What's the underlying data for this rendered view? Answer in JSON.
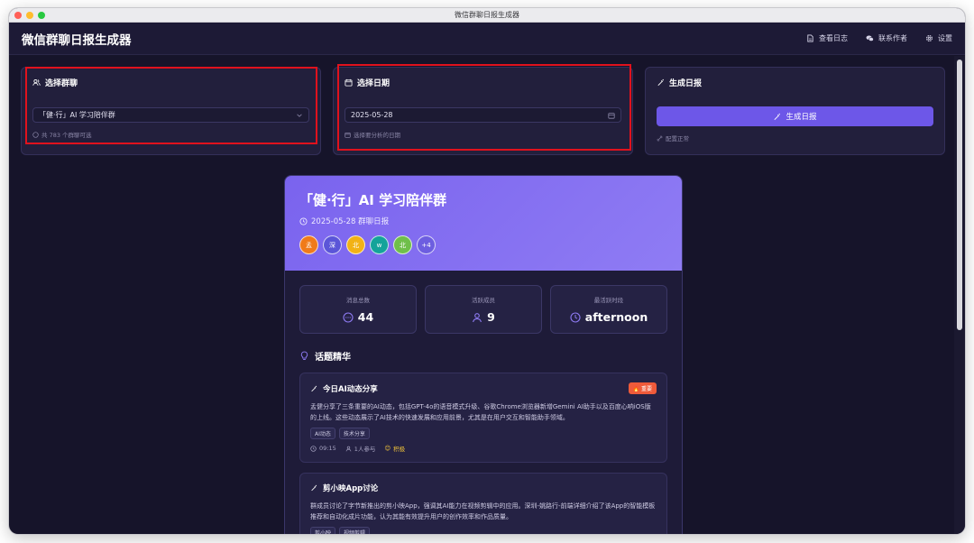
{
  "window": {
    "title": "微信群聊日报生成器"
  },
  "colors": {
    "accent": "#6d57e8",
    "highlight": "#e0121d",
    "badge": "#ef5a3a"
  },
  "header": {
    "title": "微信群聊日报生成器",
    "nav": [
      {
        "label": "查看日志",
        "icon": "document-icon"
      },
      {
        "label": "联系作者",
        "icon": "chat-icon"
      },
      {
        "label": "设置",
        "icon": "gear-icon"
      }
    ]
  },
  "group_card": {
    "title": "选择群聊",
    "selected": "「健·行」AI 学习陪伴群",
    "hint": "共 783 个群聊可选"
  },
  "date_card": {
    "title": "选择日期",
    "value": "2025-05-28",
    "hint": "选择要分析的日期"
  },
  "generate_card": {
    "title": "生成日报",
    "button": "生成日报",
    "status": "配置正常"
  },
  "report": {
    "group_name": "「健·行」AI 学习陪伴群",
    "date_line": "2025-05-28 群聊日报",
    "avatars": [
      {
        "text": "孟",
        "color": "#f07a1a"
      },
      {
        "text": "深",
        "color": "#5b55d8"
      },
      {
        "text": "北",
        "color": "#f2b215"
      },
      {
        "text": "w",
        "color": "#14a39a"
      },
      {
        "text": "北",
        "color": "#6fbf4a"
      },
      {
        "text": "+4",
        "color": "#6d5ee0"
      }
    ],
    "stats": [
      {
        "label": "消息总数",
        "value": "44",
        "icon": "message-icon"
      },
      {
        "label": "活跃成员",
        "value": "9",
        "icon": "user-icon"
      },
      {
        "label": "最活跃时段",
        "value": "afternoon",
        "icon": "clock-icon"
      }
    ],
    "section_title": "话题精华",
    "topics": [
      {
        "title": "今日AI动态分享",
        "badge": "重要",
        "desc": "孟健分享了三条重要的AI动态，包括GPT-4o的语音模式升级、谷歌Chrome浏览器新增Gemini AI助手以及百度心响iOS版的上线。这些动态展示了AI技术的快速发展和应用前景，尤其是在用户交互和智能助手领域。",
        "tags": [
          "AI动态",
          "技术分享"
        ],
        "time": "09:15",
        "participants": "1人参与",
        "sentiment": "积极"
      },
      {
        "title": "剪小映App讨论",
        "badge": "",
        "desc": "群成员讨论了字节新推出的剪小映App，强调其AI能力在视频剪辑中的应用。深圳-姚路行-前端详细介绍了该App的智能模板推荐和自动化成片功能，认为其能有效提升用户的创作效率和作品质量。",
        "tags": [
          "剪小映",
          "视频剪辑"
        ]
      }
    ]
  }
}
